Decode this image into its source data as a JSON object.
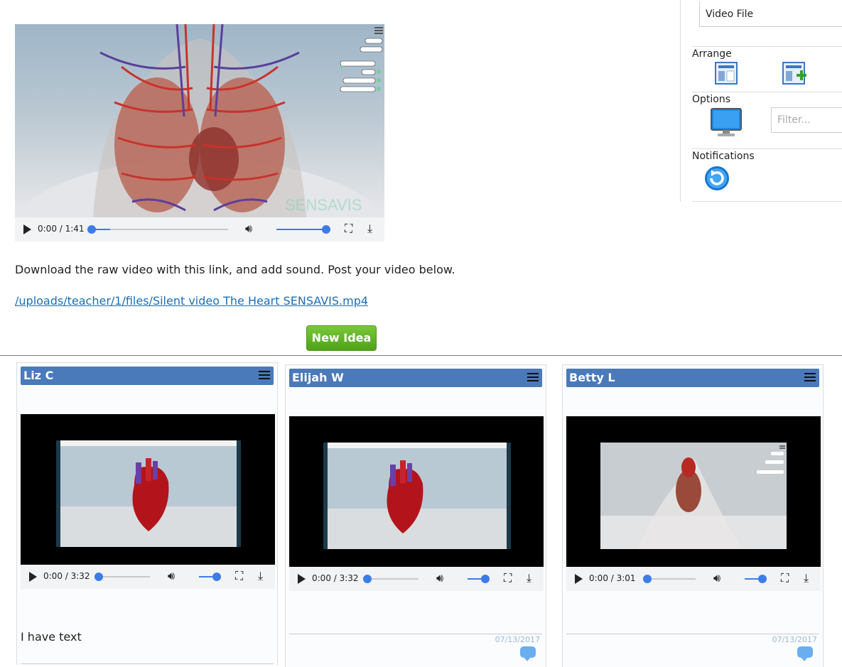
{
  "main_video": {
    "time": "0:00 / 1:41",
    "watermark": "SENSAVIS",
    "progress": 0.02,
    "volume": 1.0
  },
  "instructions": "Download the raw video with this link, and add sound. Post your video below.",
  "video_link": "/uploads/teacher/1/files/Silent video The Heart SENSAVIS.mp4",
  "new_idea_label": "New Idea",
  "sidebar": {
    "video_file_label": "Video File",
    "arrange_label": "Arrange",
    "options_label": "Options",
    "filter_placeholder": "Filter...",
    "notifications_label": "Notifications"
  },
  "cards": [
    {
      "author": "Liz C",
      "time": "0:00 / 3:32",
      "text": "I have text",
      "date": ""
    },
    {
      "author": "Elijah W",
      "time": "0:00 / 3:32",
      "text": "",
      "date": "07/13/2017"
    },
    {
      "author": "Betty L",
      "time": "0:00 / 3:01",
      "text": "",
      "date": "07/13/2017"
    }
  ],
  "colors": {
    "accent": "#3d7ce8",
    "card_header": "#4a7ab9",
    "new_idea": "#5aae22",
    "link": "#1a6fb5"
  }
}
